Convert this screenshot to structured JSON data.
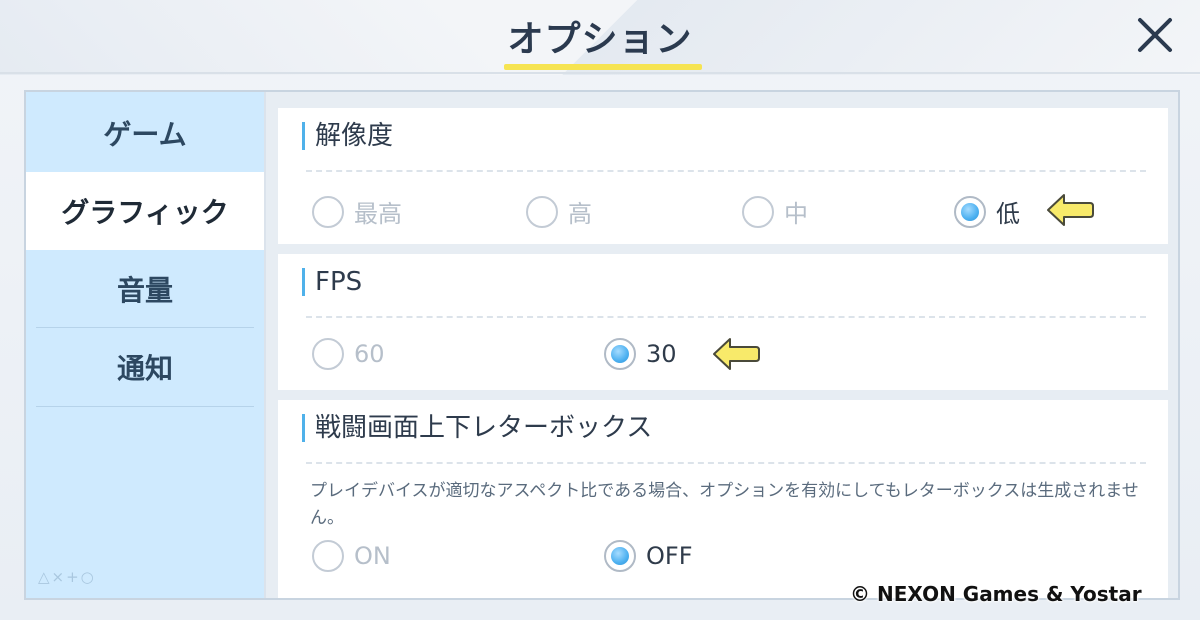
{
  "window": {
    "title": "オプション",
    "close_icon": "close-icon"
  },
  "sidebar": {
    "items": [
      {
        "label": "ゲーム",
        "active": false
      },
      {
        "label": "グラフィック",
        "active": true
      },
      {
        "label": "音量",
        "active": false
      },
      {
        "label": "通知",
        "active": false
      }
    ],
    "symbols": "△×+○"
  },
  "sections": {
    "resolution": {
      "title": "解像度",
      "options": [
        "最高",
        "高",
        "中",
        "低"
      ],
      "selected": "低"
    },
    "fps": {
      "title": "FPS",
      "options": [
        "60",
        "30"
      ],
      "selected": "30"
    },
    "letterbox": {
      "title": "戦闘画面上下レターボックス",
      "description": "プレイデバイスが適切なアスペクト比である場合、オプションを有効にしてもレターボックスは生成されません。",
      "options": [
        "ON",
        "OFF"
      ],
      "selected": "OFF"
    }
  },
  "colors": {
    "accent": "#4cb0f0",
    "title_underline": "#f6e452",
    "sidebar_bg": "#cfeafe",
    "arrow": "#f8ea6a"
  },
  "copyright": "© NEXON Games & Yostar"
}
